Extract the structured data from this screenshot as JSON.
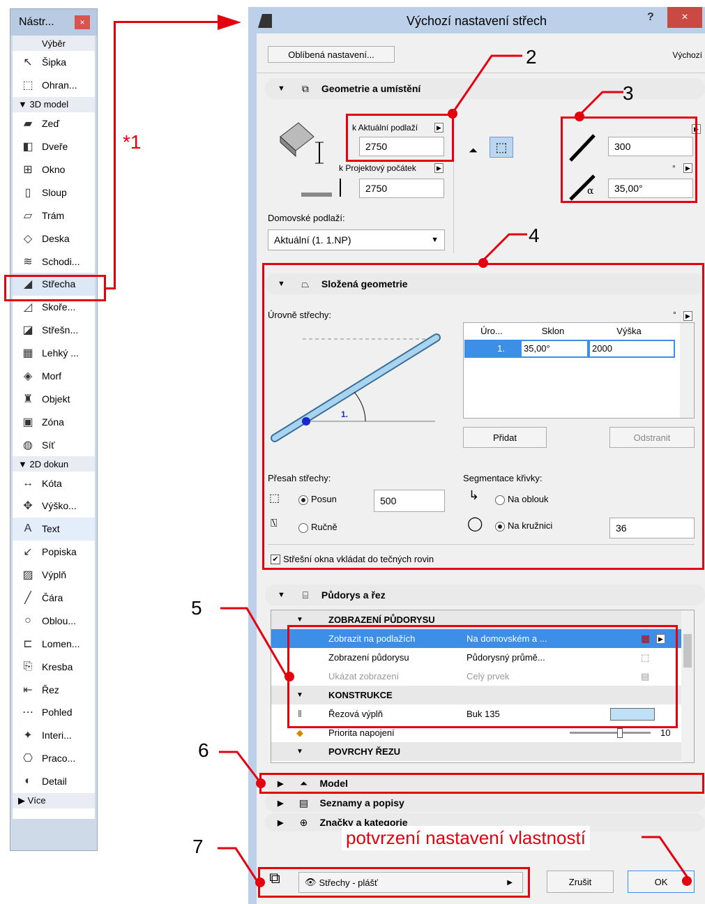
{
  "toolbox": {
    "title": "Nástr...",
    "close": "×",
    "groups": {
      "select": "Výběr",
      "model3d": "▼ 3D model",
      "dok2d": "▼ 2D dokun",
      "more": "▶  Více"
    },
    "tools3d": [
      {
        "label": "Šipka",
        "icon": "↖"
      },
      {
        "label": "Ohran...",
        "icon": "⬚"
      }
    ],
    "tools_model": [
      {
        "label": "Zeď",
        "icon": "▰"
      },
      {
        "label": "Dveře",
        "icon": "◧"
      },
      {
        "label": "Okno",
        "icon": "⊞"
      },
      {
        "label": "Sloup",
        "icon": "▯"
      },
      {
        "label": "Trám",
        "icon": "▱"
      },
      {
        "label": "Deska",
        "icon": "◇"
      },
      {
        "label": "Schodi...",
        "icon": "≋"
      },
      {
        "label": "Střecha",
        "icon": "◢"
      },
      {
        "label": "Skoře...",
        "icon": "◿"
      },
      {
        "label": "Střešn...",
        "icon": "◪"
      },
      {
        "label": "Lehký ...",
        "icon": "▦"
      },
      {
        "label": "Morf",
        "icon": "◈"
      },
      {
        "label": "Objekt",
        "icon": "♜"
      },
      {
        "label": "Zóna",
        "icon": "▣"
      },
      {
        "label": "Síť",
        "icon": "◍"
      }
    ],
    "tools_2d": [
      {
        "label": "Kóta",
        "icon": "↔"
      },
      {
        "label": "Výško...",
        "icon": "✥"
      },
      {
        "label": "Text",
        "icon": "A"
      },
      {
        "label": "Popiska",
        "icon": "↙"
      },
      {
        "label": "Výplň",
        "icon": "▨"
      },
      {
        "label": "Čára",
        "icon": "╱"
      },
      {
        "label": "Oblou...",
        "icon": "○"
      },
      {
        "label": "Lomen...",
        "icon": "⊏"
      },
      {
        "label": "Kresba",
        "icon": "⎘"
      },
      {
        "label": "Řez",
        "icon": "⇤"
      },
      {
        "label": "Pohled",
        "icon": "⋯"
      },
      {
        "label": "Interi...",
        "icon": "✦"
      },
      {
        "label": "Praco...",
        "icon": "⎔"
      },
      {
        "label": "Detail",
        "icon": "◐"
      }
    ]
  },
  "dialog": {
    "title": "Výchozí nastavení střech",
    "help": "?",
    "close": "×",
    "favorites_button": "Oblíbená nastavení...",
    "default_label": "Výchozí",
    "geometry": {
      "header": "Geometrie a umístění",
      "to_story_label": "k Aktuální podlaží",
      "to_story_value": "2750",
      "to_origin_label": "k Projektový počátek",
      "to_origin_value": "2750",
      "thickness_value": "300",
      "pitch_unit": "°",
      "pitch_value": "35,00°",
      "home_story_label": "Domovské podlaží:",
      "home_story_value": "Aktuální (1. 1.NP)"
    },
    "composite": {
      "header": "Složená geometrie",
      "levels_label": "Úrovně střechy:",
      "unit": "°",
      "table_headers": [
        "Úro...",
        "Sklon",
        "Výška"
      ],
      "table_row": [
        "1.",
        "35,00°",
        "2000"
      ],
      "diagram_label": "1.",
      "add_button": "Přidat",
      "remove_button": "Odstranit",
      "overhang_label": "Přesah střechy:",
      "offset_option": "Posun",
      "offset_value": "500",
      "manual_option": "Ručně",
      "segmentation_label": "Segmentace křivky:",
      "arc_option": "Na oblouk",
      "circle_option": "Na kružnici",
      "circle_value": "36",
      "skylight_checkbox": "Střešní okna vkládat do tečných rovin"
    },
    "floorplan": {
      "header": "Půdorys a řez",
      "group1": "ZOBRAZENÍ PŮDORYSU",
      "rows": [
        {
          "name": "Zobrazit na podlažích",
          "value": "Na domovském a ..."
        },
        {
          "name": "Zobrazení půdorysu",
          "value": "Půdorysný průmě..."
        },
        {
          "name": "Ukázat zobrazení",
          "value": "Celý prvek"
        }
      ],
      "group2": "KONSTRUKCE",
      "cut_fill_name": "Řezová výplň",
      "cut_fill_value": "Buk 135",
      "priority_name": "Priorita napojení",
      "priority_value": "10",
      "group3": "POVRCHY ŘEZU"
    },
    "model_header": "Model",
    "lists_header": "Seznamy a popisy",
    "tags_header": "Značky a kategorie",
    "layer_value": "Střechy - plášť",
    "cancel_button": "Zrušit",
    "ok_button": "OK"
  },
  "annotations": {
    "n1": "*1",
    "n2": "2",
    "n3": "3",
    "n4": "4",
    "n5": "5",
    "n6": "6",
    "n7": "7",
    "confirm_note": "potvrzení nastavení vlastností"
  },
  "colors": {
    "callout": "#e3000f",
    "selection": "#3c8ee6"
  }
}
